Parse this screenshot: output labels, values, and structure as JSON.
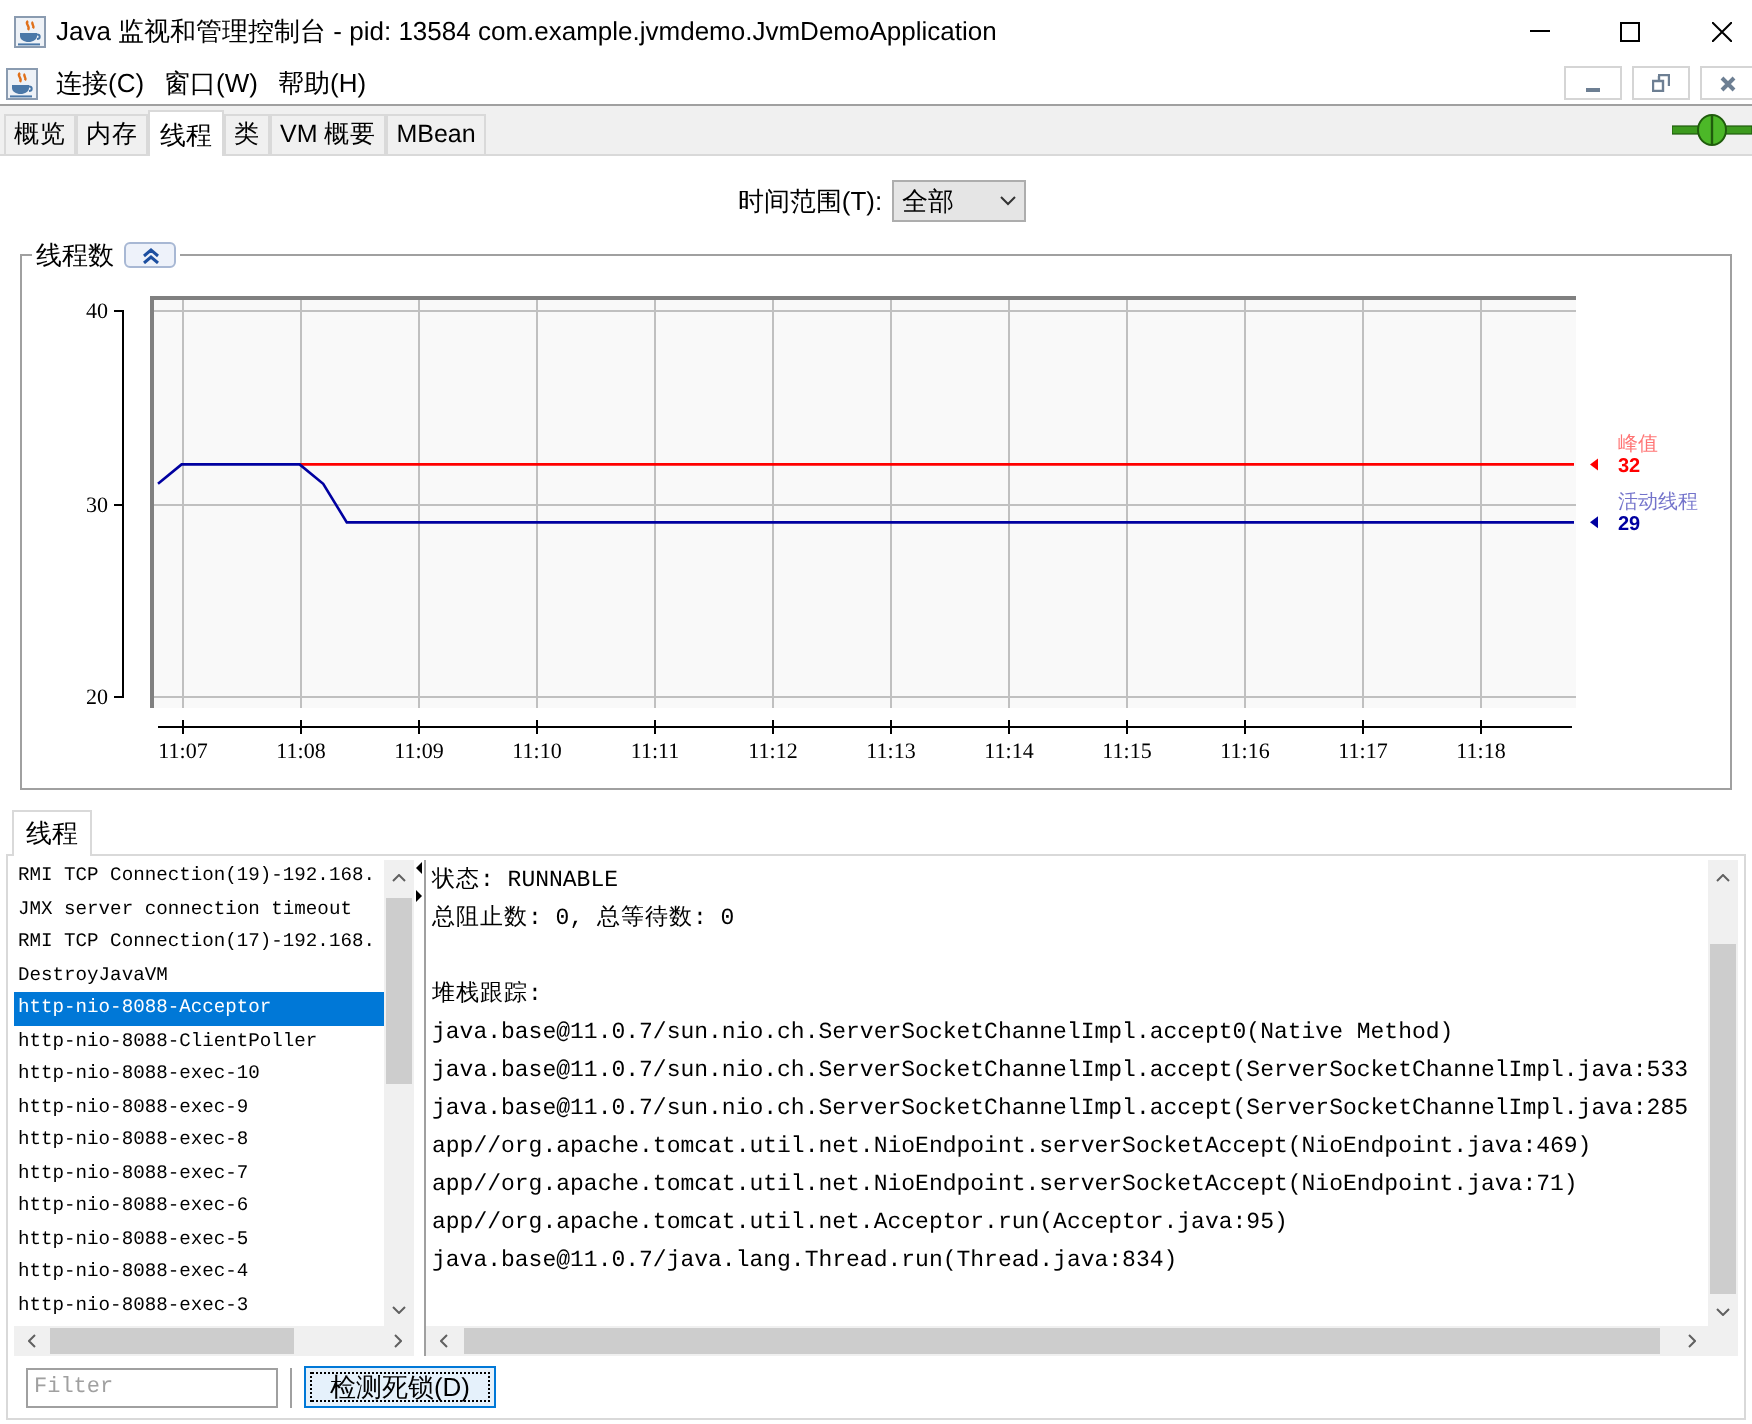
{
  "window": {
    "title": "Java 监视和管理控制台 - pid: 13584 com.example.jvmdemo.JvmDemoApplication"
  },
  "menu_bar": {
    "menus": [
      "连接(C)",
      "窗口(W)",
      "帮助(H)"
    ]
  },
  "tabs": [
    {
      "label": "概览",
      "selected": false
    },
    {
      "label": "内存",
      "selected": false
    },
    {
      "label": "线程",
      "selected": true
    },
    {
      "label": "类",
      "selected": false
    },
    {
      "label": "VM 概要",
      "selected": false
    },
    {
      "label": "MBean",
      "selected": false
    }
  ],
  "time_range": {
    "label": "时间范围(T):",
    "value": "全部"
  },
  "threads_chart": {
    "expanded": true,
    "chart_data": {
      "type": "line",
      "title": "线程数",
      "grid": true,
      "categories": [
        null,
        "11:07",
        null,
        null,
        null,
        null,
        "11:08",
        null,
        null,
        null,
        null,
        "11:09",
        null,
        null,
        null,
        null,
        "11:10",
        null,
        null,
        null,
        null,
        "11:11",
        null,
        null,
        null,
        null,
        "11:12",
        null,
        null,
        null,
        null,
        "11:13",
        null,
        null,
        null,
        null,
        "11:14",
        null,
        null,
        null,
        null,
        "11:15",
        null,
        null,
        null,
        null,
        "11:16",
        null,
        null,
        null,
        null,
        "11:17",
        null,
        null,
        null,
        null,
        "11:18",
        null,
        null,
        null,
        null
      ],
      "series": [
        {
          "name": "峰值",
          "color": "#ff0000",
          "values": [
            null,
            null,
            null,
            null,
            null,
            null,
            32,
            32,
            32,
            32,
            32,
            32,
            32,
            32,
            32,
            32,
            32,
            32,
            32,
            32,
            32,
            32,
            32,
            32,
            32,
            32,
            32,
            32,
            32,
            32,
            32,
            32,
            32,
            32,
            32,
            32,
            32,
            32,
            32,
            32,
            32,
            32,
            32,
            32,
            32,
            32,
            32,
            32,
            32,
            32,
            32,
            32,
            32,
            32,
            32,
            32,
            32,
            32,
            32,
            32,
            32
          ]
        },
        {
          "name": "活动线程",
          "color": "#0000a0",
          "values": [
            31,
            32,
            32,
            32,
            32,
            32,
            32,
            31,
            29,
            29,
            29,
            29,
            29,
            29,
            29,
            29,
            29,
            29,
            29,
            29,
            29,
            29,
            29,
            29,
            29,
            29,
            29,
            29,
            29,
            29,
            29,
            29,
            29,
            29,
            29,
            29,
            29,
            29,
            29,
            29,
            29,
            29,
            29,
            29,
            29,
            29,
            29,
            29,
            29,
            29,
            29,
            29,
            29,
            29,
            29,
            29,
            29,
            29,
            29,
            29,
            29
          ]
        }
      ],
      "ylim": [
        19.38,
        40.73
      ],
      "yticks": [
        20,
        30,
        40
      ]
    },
    "legend_values": [
      "32",
      "29"
    ]
  },
  "thread_panel": {
    "tab": {
      "label": "线程",
      "selected": true
    },
    "threads": [
      {
        "name": "RMI TCP Connection(19)-192.168.",
        "selected": false
      },
      {
        "name": "JMX server connection timeout",
        "selected": false
      },
      {
        "name": "RMI TCP Connection(17)-192.168.",
        "selected": false
      },
      {
        "name": "DestroyJavaVM",
        "selected": false
      },
      {
        "name": "http-nio-8088-Acceptor",
        "selected": true
      },
      {
        "name": "http-nio-8088-ClientPoller",
        "selected": false
      },
      {
        "name": "http-nio-8088-exec-10",
        "selected": false
      },
      {
        "name": "http-nio-8088-exec-9",
        "selected": false
      },
      {
        "name": "http-nio-8088-exec-8",
        "selected": false
      },
      {
        "name": "http-nio-8088-exec-7",
        "selected": false
      },
      {
        "name": "http-nio-8088-exec-6",
        "selected": false
      },
      {
        "name": "http-nio-8088-exec-5",
        "selected": false
      },
      {
        "name": "http-nio-8088-exec-4",
        "selected": false
      },
      {
        "name": "http-nio-8088-exec-3",
        "selected": false
      }
    ],
    "details": {
      "state": "状态: RUNNABLE",
      "counts": "总阻止数: 0, 总等待数: 0",
      "stack_trace_label": "堆栈跟踪:",
      "stack_trace": [
        "java.base@11.0.7/sun.nio.ch.ServerSocketChannelImpl.accept0(Native Method)",
        "java.base@11.0.7/sun.nio.ch.ServerSocketChannelImpl.accept(ServerSocketChannelImpl.java:533",
        "java.base@11.0.7/sun.nio.ch.ServerSocketChannelImpl.accept(ServerSocketChannelImpl.java:285",
        "app//org.apache.tomcat.util.net.NioEndpoint.serverSocketAccept(NioEndpoint.java:469)",
        "app//org.apache.tomcat.util.net.NioEndpoint.serverSocketAccept(NioEndpoint.java:71)",
        "app//org.apache.tomcat.util.net.Acceptor.run(Acceptor.java:95)",
        "java.base@11.0.7/java.lang.Thread.run(Thread.java:834)"
      ]
    },
    "filter": {
      "placeholder": "Filter"
    },
    "detect_deadlock_button": "检测死锁(D)"
  }
}
